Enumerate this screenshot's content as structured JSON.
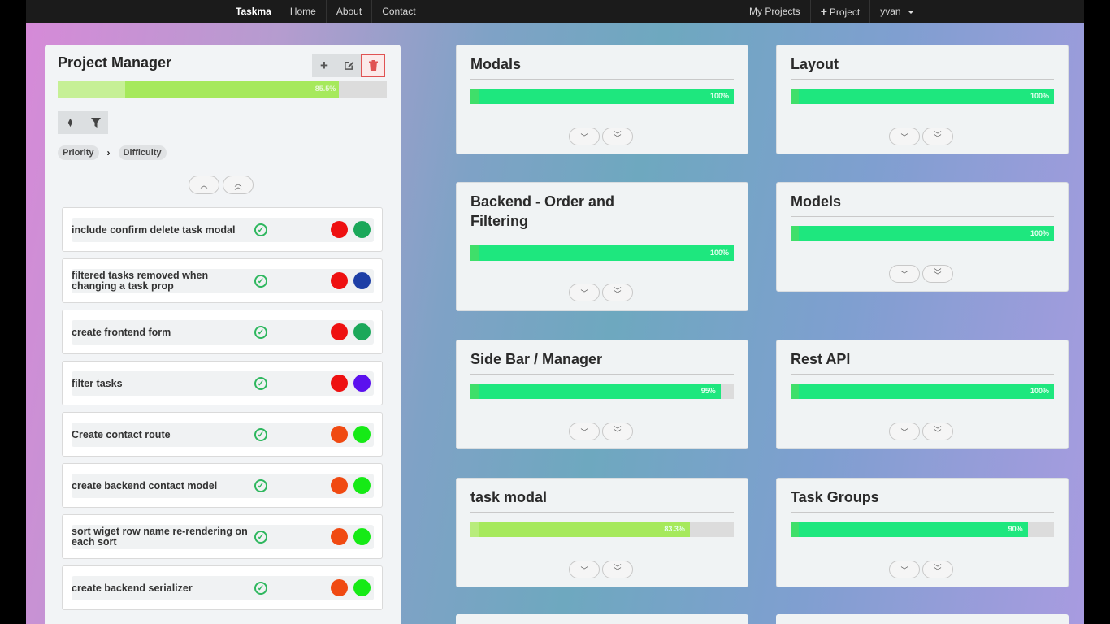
{
  "navbar": {
    "brand": "Taskma",
    "links": [
      "Home",
      "About",
      "Contact"
    ],
    "my_projects": "My Projects",
    "new_project": "Project",
    "user": "yvan"
  },
  "manager": {
    "title": "Project Manager",
    "progress_pct": 85.5,
    "progress_label": "85.5%",
    "sort_labels": [
      "Priority",
      "Difficulty"
    ],
    "tasks": [
      {
        "name": "include confirm delete task modal",
        "priority_color": "#ee1111",
        "difficulty_color": "#1ba85a"
      },
      {
        "name": "filtered tasks removed when changing a task prop",
        "priority_color": "#ee1111",
        "difficulty_color": "#1e3fa6"
      },
      {
        "name": "create frontend form",
        "priority_color": "#ee1111",
        "difficulty_color": "#1ba85a"
      },
      {
        "name": "filter tasks",
        "priority_color": "#ee1111",
        "difficulty_color": "#5b11ee"
      },
      {
        "name": "Create contact route",
        "priority_color": "#f04a12",
        "difficulty_color": "#16ea16"
      },
      {
        "name": "create backend contact model",
        "priority_color": "#f04a12",
        "difficulty_color": "#16ea16"
      },
      {
        "name": "sort wiget row name re-rendering on each sort",
        "priority_color": "#f04a12",
        "difficulty_color": "#16ea16"
      },
      {
        "name": "create backend serializer",
        "priority_color": "#f04a12",
        "difficulty_color": "#16ea16"
      }
    ]
  },
  "projects": [
    {
      "title": "Modals",
      "pct": 100,
      "label": "100%",
      "color": "green"
    },
    {
      "title": "Layout",
      "pct": 100,
      "label": "100%",
      "color": "green"
    },
    {
      "title": "Backend - Order and Filtering",
      "pct": 100,
      "label": "100%",
      "color": "green"
    },
    {
      "title": "Models",
      "pct": 100,
      "label": "100%",
      "color": "green"
    },
    {
      "title": "Side Bar / Manager",
      "pct": 95,
      "label": "95%",
      "color": "green"
    },
    {
      "title": "Rest API",
      "pct": 100,
      "label": "100%",
      "color": "green"
    },
    {
      "title": "task modal",
      "pct": 83.3,
      "label": "83.3%",
      "color": "yellow"
    },
    {
      "title": "Task Groups",
      "pct": 90,
      "label": "90%",
      "color": "green"
    }
  ]
}
